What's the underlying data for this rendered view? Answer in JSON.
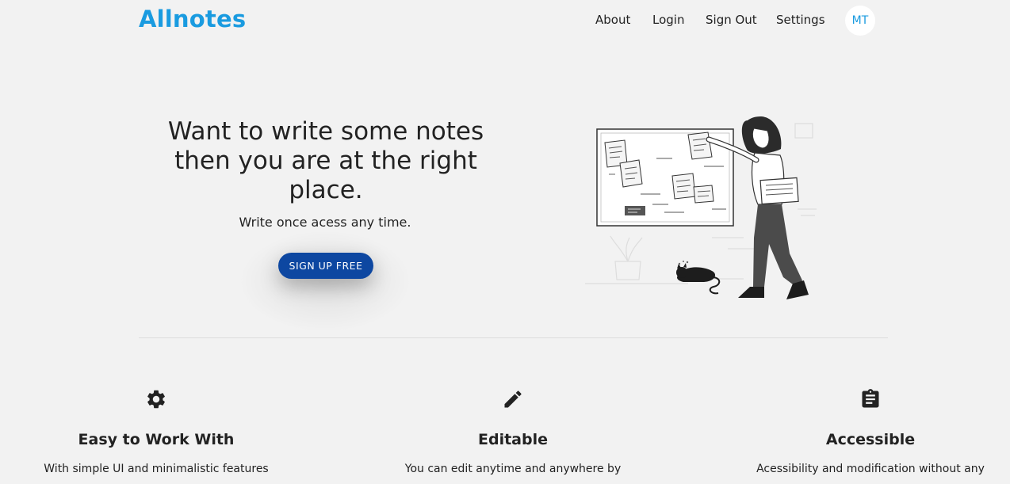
{
  "header": {
    "logo": "Allnotes",
    "nav": {
      "about": "About",
      "login": "Login",
      "sign_out": "Sign Out",
      "settings": "Settings"
    },
    "avatar_initials": "MT"
  },
  "hero": {
    "title": "Want to write some notes then you are at the right place.",
    "subtitle": "Write once acess any time.",
    "cta_label": "SIGN UP FREE",
    "illustration_icon": "woman-pinning-notes-on-board-illustration"
  },
  "features": [
    {
      "icon": "gear-icon",
      "title": "Easy to Work With",
      "text": "With simple UI and minimalistic features"
    },
    {
      "icon": "pencil-icon",
      "title": "Editable",
      "text": "You can edit anytime and anywhere by"
    },
    {
      "icon": "clipboard-icon",
      "title": "Accessible",
      "text": "Acessibility and modification without any"
    }
  ],
  "colors": {
    "brand": "#1a9be0",
    "cta": "#0d47a1",
    "background": "#f2f2f2"
  }
}
